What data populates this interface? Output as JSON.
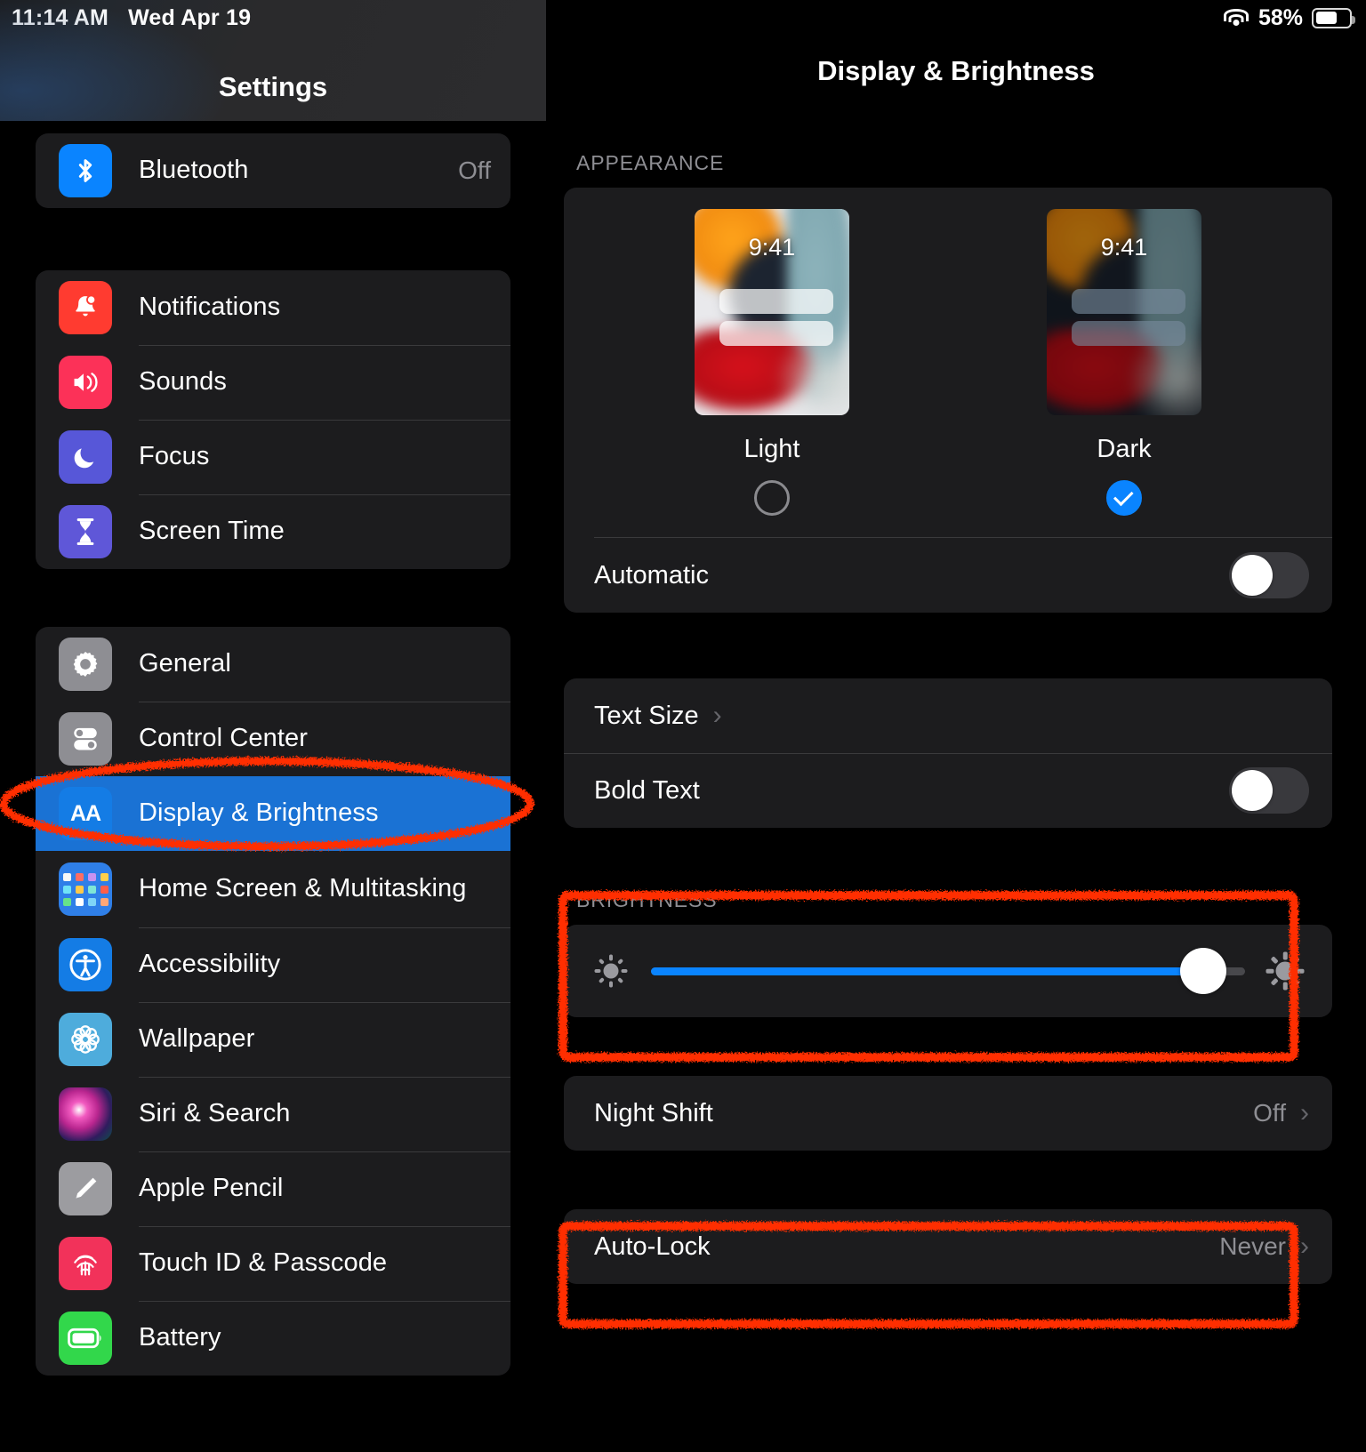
{
  "status_bar": {
    "time": "11:14 AM",
    "date": "Wed Apr 19",
    "wifi_icon": "wifi-icon",
    "battery_percent": "58%",
    "battery_icon": "battery-icon"
  },
  "sidebar": {
    "title": "Settings",
    "groups": [
      {
        "items": [
          {
            "label": "Bluetooth",
            "value": "Off",
            "icon": "bluetooth-icon",
            "icon_color": "#0a84ff",
            "selected": false
          }
        ]
      },
      {
        "items": [
          {
            "label": "Notifications",
            "value": "",
            "icon": "bell-icon",
            "icon_color": "#ff3b30",
            "selected": false
          },
          {
            "label": "Sounds",
            "value": "",
            "icon": "speaker-icon",
            "icon_color": "#fc3158",
            "selected": false
          },
          {
            "label": "Focus",
            "value": "",
            "icon": "moon-icon",
            "icon_color": "#5757d8",
            "selected": false
          },
          {
            "label": "Screen Time",
            "value": "",
            "icon": "hourglass-icon",
            "icon_color": "#5f57d8",
            "selected": false
          }
        ]
      },
      {
        "items": [
          {
            "label": "General",
            "value": "",
            "icon": "gear-icon",
            "icon_color": "#8e8e93",
            "selected": false
          },
          {
            "label": "Control Center",
            "value": "",
            "icon": "toggles-icon",
            "icon_color": "#8e8e93",
            "selected": false
          },
          {
            "label": "Display & Brightness",
            "value": "",
            "icon": "text-size-aa-icon",
            "icon_color": "#147ce5",
            "selected": true
          },
          {
            "label": "Home Screen & Multitasking",
            "value": "",
            "icon": "app-grid-icon",
            "icon_color": "#2f7fe8",
            "selected": false
          },
          {
            "label": "Accessibility",
            "value": "",
            "icon": "accessibility-person-icon",
            "icon_color": "#147ce5",
            "selected": false
          },
          {
            "label": "Wallpaper",
            "value": "",
            "icon": "flower-icon",
            "icon_color": "#4eacdc",
            "selected": false
          },
          {
            "label": "Siri & Search",
            "value": "",
            "icon": "siri-orb-icon",
            "icon_color": "#b9268f",
            "selected": false
          },
          {
            "label": "Apple Pencil",
            "value": "",
            "icon": "pencil-icon",
            "icon_color": "#9c9ca0",
            "selected": false
          },
          {
            "label": "Touch ID & Passcode",
            "value": "",
            "icon": "fingerprint-icon",
            "icon_color": "#f2325a",
            "selected": false
          },
          {
            "label": "Battery",
            "value": "",
            "icon": "battery-icon",
            "icon_color": "#32d74b",
            "selected": false
          }
        ]
      }
    ]
  },
  "detail": {
    "title": "Display & Brightness",
    "appearance": {
      "section_label": "APPEARANCE",
      "options": [
        {
          "name": "Light",
          "clock": "9:41",
          "selected": false
        },
        {
          "name": "Dark",
          "clock": "9:41",
          "selected": true
        }
      ],
      "automatic": {
        "label": "Automatic",
        "state": "off"
      }
    },
    "text_group": {
      "text_size": {
        "label": "Text Size",
        "chevron": "chevron-right-icon"
      },
      "bold_text": {
        "label": "Bold Text",
        "state": "off"
      }
    },
    "brightness": {
      "section_label": "BRIGHTNESS",
      "value_percent": 93,
      "low_icon": "sun-min-icon",
      "high_icon": "sun-max-icon"
    },
    "night_shift": {
      "label": "Night Shift",
      "value": "Off",
      "chevron": "chevron-right-icon"
    },
    "auto_lock": {
      "label": "Auto-Lock",
      "value": "Never",
      "chevron": "chevron-right-icon"
    },
    "accent_color": "#0a84ff"
  },
  "annotations": {
    "color": "#ff2d00",
    "items": [
      {
        "shape": "ellipse",
        "target": "Display & Brightness"
      },
      {
        "shape": "rectangle",
        "target": "BRIGHTNESS"
      },
      {
        "shape": "rectangle",
        "target": "Auto-Lock"
      }
    ]
  }
}
